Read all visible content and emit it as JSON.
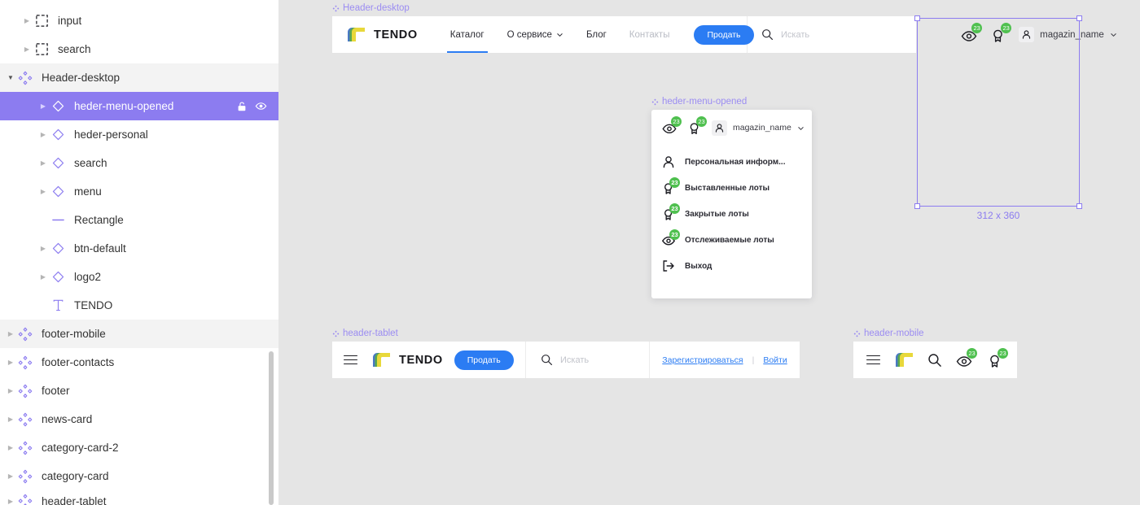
{
  "app": {
    "selection_size": "312 x 360",
    "accent_purple": "#8c7cf0",
    "accent_blue": "#2b7cf3",
    "badge_green": "#4fc04f"
  },
  "sidebar": {
    "layers": [
      {
        "name": "",
        "icon": "frame-icon",
        "indent": 1,
        "twisty": "collapsed",
        "state": "clipped-top",
        "selected": false
      },
      {
        "name": "input",
        "icon": "frame-icon",
        "indent": 1,
        "twisty": "collapsed",
        "state": "normal",
        "selected": false
      },
      {
        "name": "search",
        "icon": "frame-icon",
        "indent": 1,
        "twisty": "collapsed",
        "state": "normal",
        "selected": false
      },
      {
        "name": "Header-desktop",
        "icon": "component-icon",
        "indent": 0,
        "twisty": "expanded",
        "state": "group",
        "selected": false
      },
      {
        "name": "heder-menu-opened",
        "icon": "instance-icon",
        "indent": 2,
        "twisty": "collapsed",
        "state": "normal",
        "selected": true
      },
      {
        "name": "heder-personal",
        "icon": "instance-icon",
        "indent": 2,
        "twisty": "collapsed",
        "state": "normal",
        "selected": false
      },
      {
        "name": "search",
        "icon": "instance-icon",
        "indent": 2,
        "twisty": "collapsed",
        "state": "normal",
        "selected": false
      },
      {
        "name": "menu",
        "icon": "instance-icon",
        "indent": 2,
        "twisty": "collapsed",
        "state": "normal",
        "selected": false
      },
      {
        "name": "Rectangle",
        "icon": "line-icon",
        "indent": 2,
        "twisty": "none",
        "state": "normal",
        "selected": false
      },
      {
        "name": "btn-default",
        "icon": "instance-icon",
        "indent": 2,
        "twisty": "collapsed",
        "state": "normal",
        "selected": false
      },
      {
        "name": "logo2",
        "icon": "instance-icon",
        "indent": 2,
        "twisty": "collapsed",
        "state": "normal",
        "selected": false
      },
      {
        "name": "TENDO",
        "icon": "text-icon",
        "indent": 2,
        "twisty": "none",
        "state": "normal",
        "selected": false
      },
      {
        "name": "footer-mobile",
        "icon": "component-icon",
        "indent": 0,
        "twisty": "collapsed",
        "state": "group",
        "selected": false
      },
      {
        "name": "footer-contacts",
        "icon": "component-icon",
        "indent": 0,
        "twisty": "collapsed",
        "state": "normal",
        "selected": false
      },
      {
        "name": "footer",
        "icon": "component-icon",
        "indent": 0,
        "twisty": "collapsed",
        "state": "normal",
        "selected": false
      },
      {
        "name": "news-card",
        "icon": "component-icon",
        "indent": 0,
        "twisty": "collapsed",
        "state": "normal",
        "selected": false
      },
      {
        "name": "category-card-2",
        "icon": "component-icon",
        "indent": 0,
        "twisty": "collapsed",
        "state": "normal",
        "selected": false
      },
      {
        "name": "category-card",
        "icon": "component-icon",
        "indent": 0,
        "twisty": "collapsed",
        "state": "normal",
        "selected": false
      },
      {
        "name": "header-tablet",
        "icon": "component-icon",
        "indent": 0,
        "twisty": "collapsed",
        "state": "clipped-bottom",
        "selected": false
      }
    ],
    "row_actions": {
      "lock": "unlock-icon",
      "visibility": "eye-icon"
    }
  },
  "canvas": {
    "frames": {
      "desktop": {
        "label": "Header-desktop",
        "logo_text": "TENDO",
        "nav": [
          {
            "label": "Каталог",
            "active": true,
            "muted": false,
            "caret": false
          },
          {
            "label": "О сервисе",
            "active": false,
            "muted": false,
            "caret": true
          },
          {
            "label": "Блог",
            "active": false,
            "muted": false,
            "caret": false
          },
          {
            "label": "Контакты",
            "active": false,
            "muted": true,
            "caret": false
          }
        ],
        "sell_button": "Продать",
        "search_placeholder": "Искать",
        "watch_badge": "23",
        "lots_badge": "23",
        "user_name": "magazin_name"
      },
      "menu": {
        "label": "heder-menu-opened",
        "watch_badge": "23",
        "lots_badge": "23",
        "user_name": "magazin_name",
        "items": [
          {
            "label": "Персональная информ...",
            "icon": "person-icon",
            "badge": ""
          },
          {
            "label": "Выставленные лоты",
            "icon": "lot-icon",
            "badge": "23"
          },
          {
            "label": "Закрытые лоты",
            "icon": "lot-icon",
            "badge": "23"
          },
          {
            "label": "Отслеживаемые лоты",
            "icon": "eye-icon",
            "badge": "23"
          },
          {
            "label": "Выход",
            "icon": "logout-icon",
            "badge": ""
          }
        ]
      },
      "tablet": {
        "label": "header-tablet",
        "logo_text": "TENDO",
        "sell_button": "Продать",
        "search_placeholder": "Искать",
        "register_link": "Зарегистрироваться",
        "separator": "|",
        "login_link": "Войти"
      },
      "mobile": {
        "label": "header-mobile",
        "watch_badge": "23",
        "lots_badge": "23"
      }
    }
  }
}
